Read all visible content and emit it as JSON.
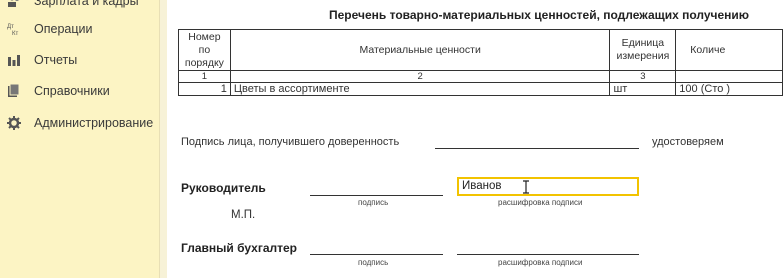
{
  "sidebar": {
    "items": [
      {
        "label": "Зарплата и кадры",
        "icon": "people-icon"
      },
      {
        "label": "Операции",
        "icon": "debit-credit-icon"
      },
      {
        "label": "Отчеты",
        "icon": "bar-chart-icon"
      },
      {
        "label": "Справочники",
        "icon": "books-icon"
      },
      {
        "label": "Администрирование",
        "icon": "gear-icon"
      }
    ]
  },
  "document": {
    "title": "Перечень товарно-материальных ценностей, подлежащих получению",
    "table": {
      "headers": [
        "Номер по порядку",
        "Материальные ценности",
        "Единица измерения",
        "Количе"
      ],
      "col_numbers": [
        "1",
        "2",
        "3",
        ""
      ],
      "rows": [
        {
          "num": "1",
          "name": "Цветы в ассортименте",
          "unit": "шт",
          "qty": "100 (Сто )"
        }
      ]
    },
    "signature_text": "Подпись лица, получившего доверенность",
    "certify_text": "удостоверяем",
    "head_label": "Руководитель",
    "head_name": "Иванов",
    "stamp": "М.П.",
    "accountant_label": "Главный бухгалтер",
    "podpis_label": "подпись",
    "rasshifrovka_label": "расшифровка подписи"
  }
}
